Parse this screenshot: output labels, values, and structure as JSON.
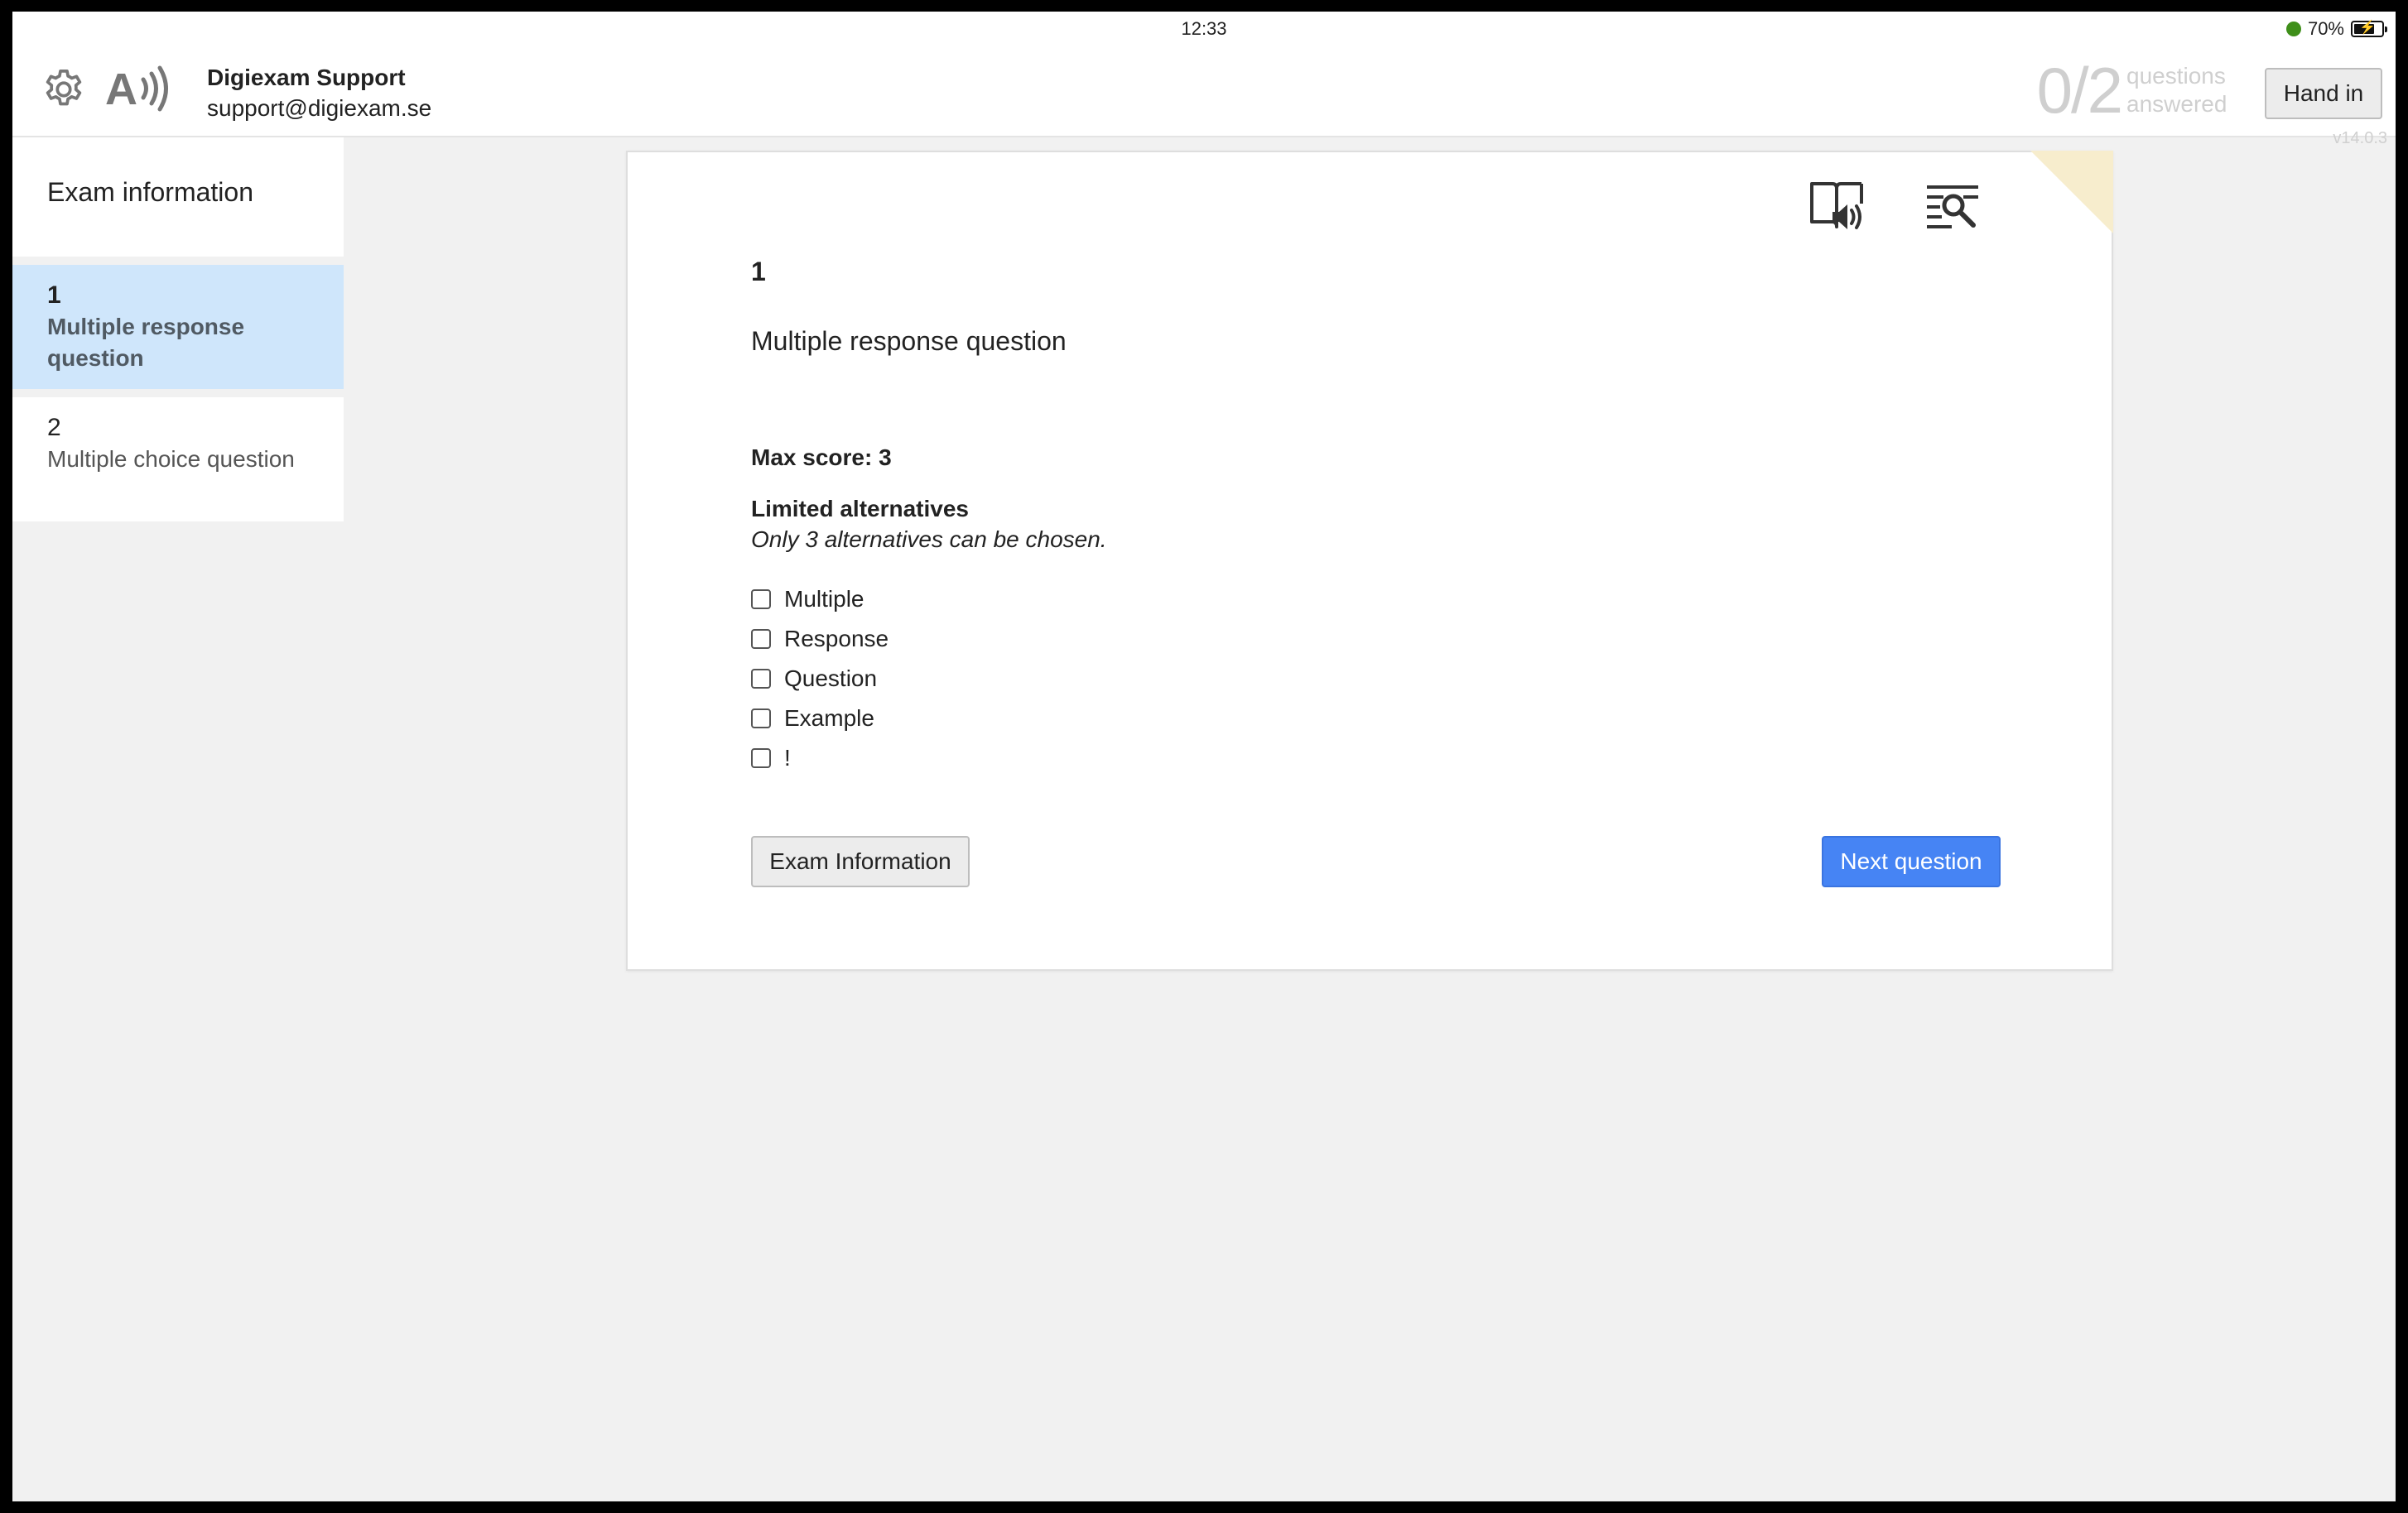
{
  "status_bar": {
    "time": "12:33",
    "battery_percent": "70%",
    "battery_level": 0.7,
    "network_color": "#3f8f1a",
    "icons": [
      "network-dot-icon",
      "battery-charging-icon"
    ]
  },
  "header": {
    "settings_icon": "gear-icon",
    "tts_icon": "text-to-speech-icon",
    "user_name": "Digiexam Support",
    "user_email": "support@digiexam.se",
    "progress": {
      "count": "0/2",
      "label": "questions answered",
      "answered": 0,
      "total": 2
    },
    "hand_in_label": "Hand in"
  },
  "version": "v14.0.3",
  "sidebar": {
    "exam_info_label": "Exam information",
    "items": [
      {
        "number": "1",
        "label": "Multiple response question",
        "active": true
      },
      {
        "number": "2",
        "label": "Multiple choice question",
        "active": false
      }
    ]
  },
  "question": {
    "tools": [
      "read-aloud-icon",
      "search-text-icon"
    ],
    "number": "1",
    "title": "Multiple response question",
    "max_score": "Max score: 3",
    "limit_title": "Limited alternatives",
    "limit_desc": "Only 3 alternatives can be chosen.",
    "options": [
      {
        "label": "Multiple",
        "checked": false
      },
      {
        "label": "Response",
        "checked": false
      },
      {
        "label": "Question",
        "checked": false
      },
      {
        "label": "Example",
        "checked": false
      },
      {
        "label": "!",
        "checked": false
      }
    ],
    "exam_info_button": "Exam Information",
    "next_button": "Next question"
  },
  "colors": {
    "accent": "#4684f4",
    "active_sidebar": "#cfe6fb",
    "card_corner": "#f7edcd",
    "background": "#f1f1f1"
  }
}
